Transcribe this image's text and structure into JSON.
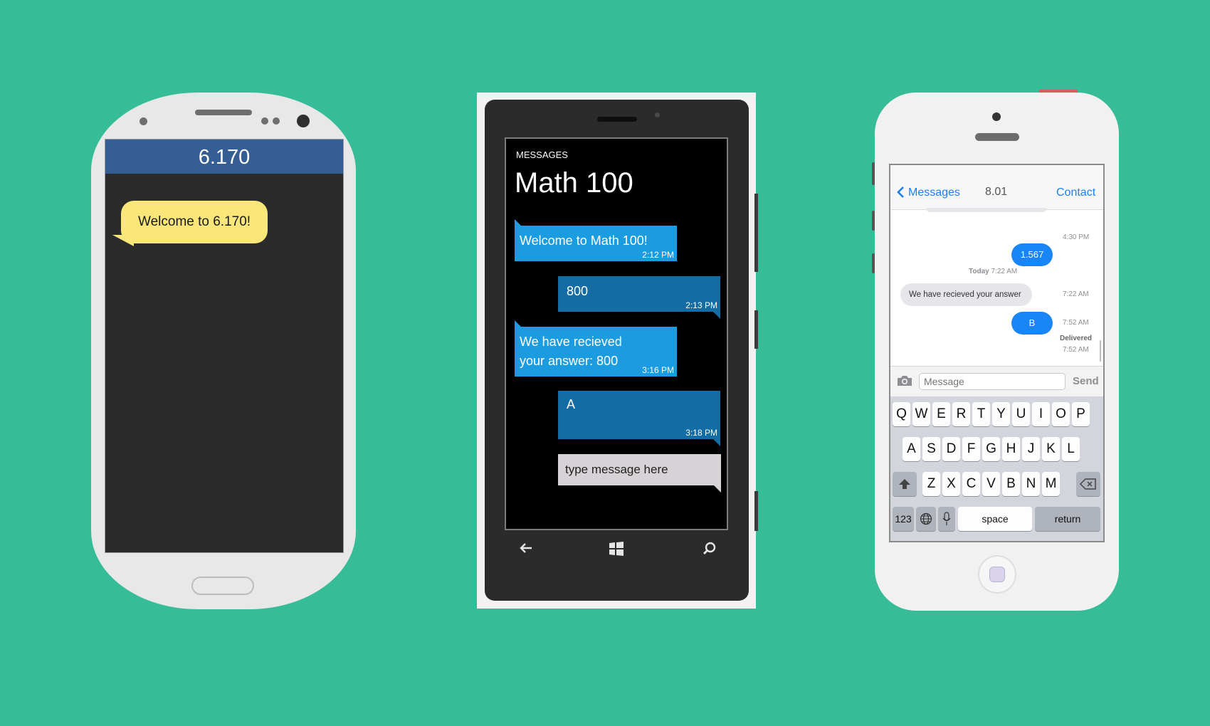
{
  "android": {
    "header_title": "6.170",
    "messages": [
      {
        "text": "Welcome to 6.170!"
      }
    ]
  },
  "windows": {
    "app_label": "MESSAGES",
    "conversation_title": "Math 100",
    "messages": [
      {
        "direction": "in",
        "text": "Welcome to Math 100!",
        "time": "2:12 PM"
      },
      {
        "direction": "out",
        "text": "800",
        "time": "2:13 PM"
      },
      {
        "direction": "in",
        "text": "We have recieved your answer: 800",
        "time": "3:16 PM"
      },
      {
        "direction": "out",
        "text": "A",
        "time": "3:18 PM"
      }
    ],
    "compose_placeholder": "type message here",
    "nav": {
      "back_icon": "back-arrow-icon",
      "start_icon": "windows-logo-icon",
      "search_icon": "search-icon"
    }
  },
  "iphone": {
    "nav": {
      "back_label": "Messages",
      "title": "8.01",
      "contact_label": "Contact"
    },
    "thread": [
      {
        "kind": "time",
        "text": "4:30 PM"
      },
      {
        "kind": "out",
        "text": "1.567"
      },
      {
        "kind": "day",
        "day": "Today",
        "time": "7:22 AM"
      },
      {
        "kind": "in",
        "text": "We have recieved your answer",
        "time": "7:22 AM"
      },
      {
        "kind": "out",
        "text": "B",
        "time": "7:52 AM"
      },
      {
        "kind": "status",
        "text": "Delivered",
        "time": "7:52 AM"
      }
    ],
    "compose": {
      "placeholder": "Message",
      "send_label": "Send",
      "camera_icon": "camera-icon"
    },
    "keyboard": {
      "row1": [
        "Q",
        "W",
        "E",
        "R",
        "T",
        "Y",
        "U",
        "I",
        "O",
        "P"
      ],
      "row2": [
        "A",
        "S",
        "D",
        "F",
        "G",
        "H",
        "J",
        "K",
        "L"
      ],
      "row3": [
        "Z",
        "X",
        "C",
        "V",
        "B",
        "N",
        "M"
      ],
      "shift_icon": "shift-icon",
      "delete_icon": "delete-icon",
      "numbers_label": "123",
      "globe_icon": "globe-icon",
      "mic_icon": "microphone-icon",
      "space_label": "space",
      "return_label": "return"
    }
  }
}
